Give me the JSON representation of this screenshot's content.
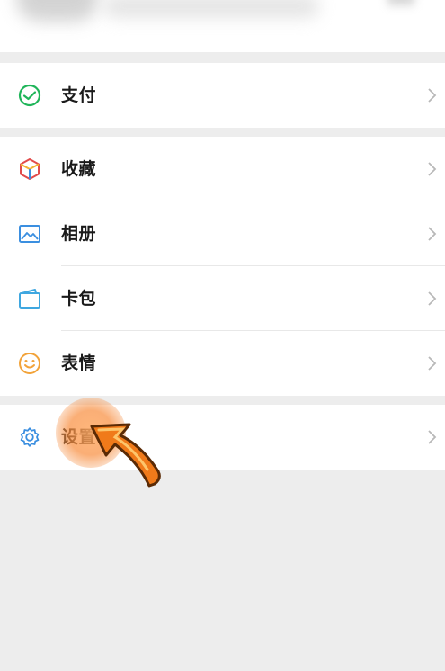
{
  "menu": {
    "pay_label": "支付",
    "favorites_label": "收藏",
    "album_label": "相册",
    "cards_label": "卡包",
    "stickers_label": "表情",
    "settings_label": "设置"
  },
  "icons": {
    "pay": "pay-icon",
    "favorites": "favorites-cube-icon",
    "album": "album-picture-icon",
    "cards": "card-wallet-icon",
    "stickers": "smiley-icon",
    "settings": "gear-icon",
    "chevron": "chevron-right-icon"
  },
  "colors": {
    "pay_green": "#20b55a",
    "album_blue": "#3b8fe0",
    "cards_blue": "#3fa7e0",
    "stickers_orange": "#f2a33a",
    "settings_blue": "#3b8fe0",
    "pointer_orange": "#f07a1a",
    "background": "#ededed"
  }
}
